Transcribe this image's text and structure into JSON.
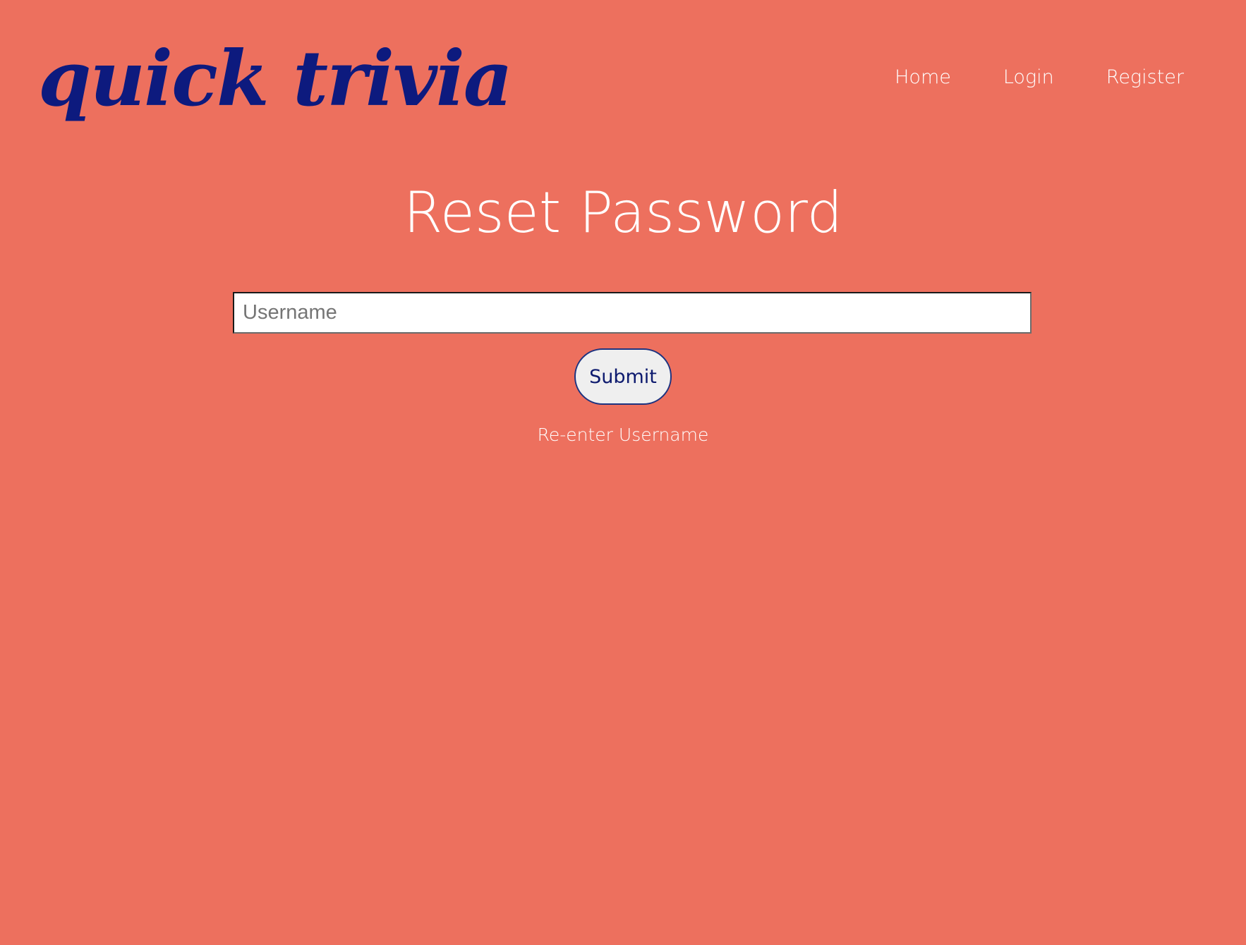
{
  "header": {
    "logo_text": "quick trivia",
    "nav": {
      "home": "Home",
      "login": "Login",
      "register": "Register"
    }
  },
  "main": {
    "title": "Reset Password",
    "username_placeholder": "Username",
    "username_value": "",
    "submit_label": "Submit",
    "reenter_label": "Re-enter Username"
  },
  "colors": {
    "background": "#ed705e",
    "logo": "#0d1a7e",
    "nav_text": "#ffffff",
    "button_background": "#efefef",
    "button_text": "#0d1a6e"
  }
}
